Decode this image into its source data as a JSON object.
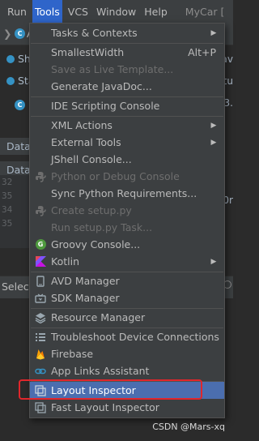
{
  "menubar": {
    "items": [
      {
        "label": "Run",
        "active": false
      },
      {
        "label": "Tools",
        "active": true
      },
      {
        "label": "VCS",
        "active": false
      },
      {
        "label": "Window",
        "active": false
      },
      {
        "label": "Help",
        "active": false
      }
    ],
    "project": "MyCar ["
  },
  "background": {
    "toolbar_fragment": "A",
    "rows": [
      "Short",
      "State"
    ],
    "tabs": [
      "Data",
      "Data"
    ],
    "line_numbers": [
      "32",
      "35",
      "34",
      "35"
    ],
    "select_label": "Select",
    "right_fragments": [
      "av",
      "ctu",
      "03.",
      "0r"
    ]
  },
  "tools_menu": {
    "items": [
      {
        "id": "tasks",
        "label": "Tasks & Contexts",
        "submenu": true,
        "icon": "none"
      },
      {
        "id": "smallest",
        "label": "SmallestWidth",
        "shortcut": "Alt+P",
        "icon": "none"
      },
      {
        "id": "live-template",
        "label": "Save as Live Template...",
        "disabled": true,
        "icon": "none"
      },
      {
        "id": "javadoc",
        "label": "Generate JavaDoc...",
        "icon": "none"
      },
      {
        "id": "ide-scripting",
        "label": "IDE Scripting Console",
        "icon": "none"
      },
      {
        "id": "xml-actions",
        "label": "XML Actions",
        "submenu": true,
        "icon": "none"
      },
      {
        "id": "external-tools",
        "label": "External Tools",
        "submenu": true,
        "icon": "none"
      },
      {
        "id": "jshell",
        "label": "JShell Console...",
        "icon": "none"
      },
      {
        "id": "python-debug",
        "label": "Python or Debug Console",
        "disabled": true,
        "icon": "python-icon"
      },
      {
        "id": "sync-python",
        "label": "Sync Python Requirements...",
        "icon": "none"
      },
      {
        "id": "create-setup",
        "label": "Create setup.py",
        "disabled": true,
        "icon": "python-icon"
      },
      {
        "id": "run-setup",
        "label": "Run setup.py Task...",
        "disabled": true,
        "icon": "none"
      },
      {
        "id": "groovy",
        "label": "Groovy Console...",
        "icon": "groovy-icon"
      },
      {
        "id": "kotlin",
        "label": "Kotlin",
        "submenu": true,
        "icon": "kotlin-icon"
      },
      {
        "id": "avd",
        "label": "AVD Manager",
        "icon": "avd-icon"
      },
      {
        "id": "sdk",
        "label": "SDK Manager",
        "icon": "sdk-icon"
      },
      {
        "id": "resource",
        "label": "Resource Manager",
        "icon": "resource-icon"
      },
      {
        "id": "troubleshoot",
        "label": "Troubleshoot Device Connections",
        "icon": "list-icon"
      },
      {
        "id": "firebase",
        "label": "Firebase",
        "icon": "firebase-icon"
      },
      {
        "id": "app-links",
        "label": "App Links Assistant",
        "icon": "link-icon"
      },
      {
        "id": "layout-inspector",
        "label": "Layout Inspector",
        "highlighted": true,
        "icon": "layout-inspector-icon"
      },
      {
        "id": "fast-layout-inspector",
        "label": "Fast Layout Inspector",
        "icon": "layout-inspector-icon"
      }
    ]
  },
  "colors": {
    "menu_bg": "#3c3f41",
    "selection": "#4b6eaf",
    "active_menu": "#2f65ca",
    "annotation_red": "#e1262b"
  },
  "watermark": "CSDN @Mars-xq"
}
